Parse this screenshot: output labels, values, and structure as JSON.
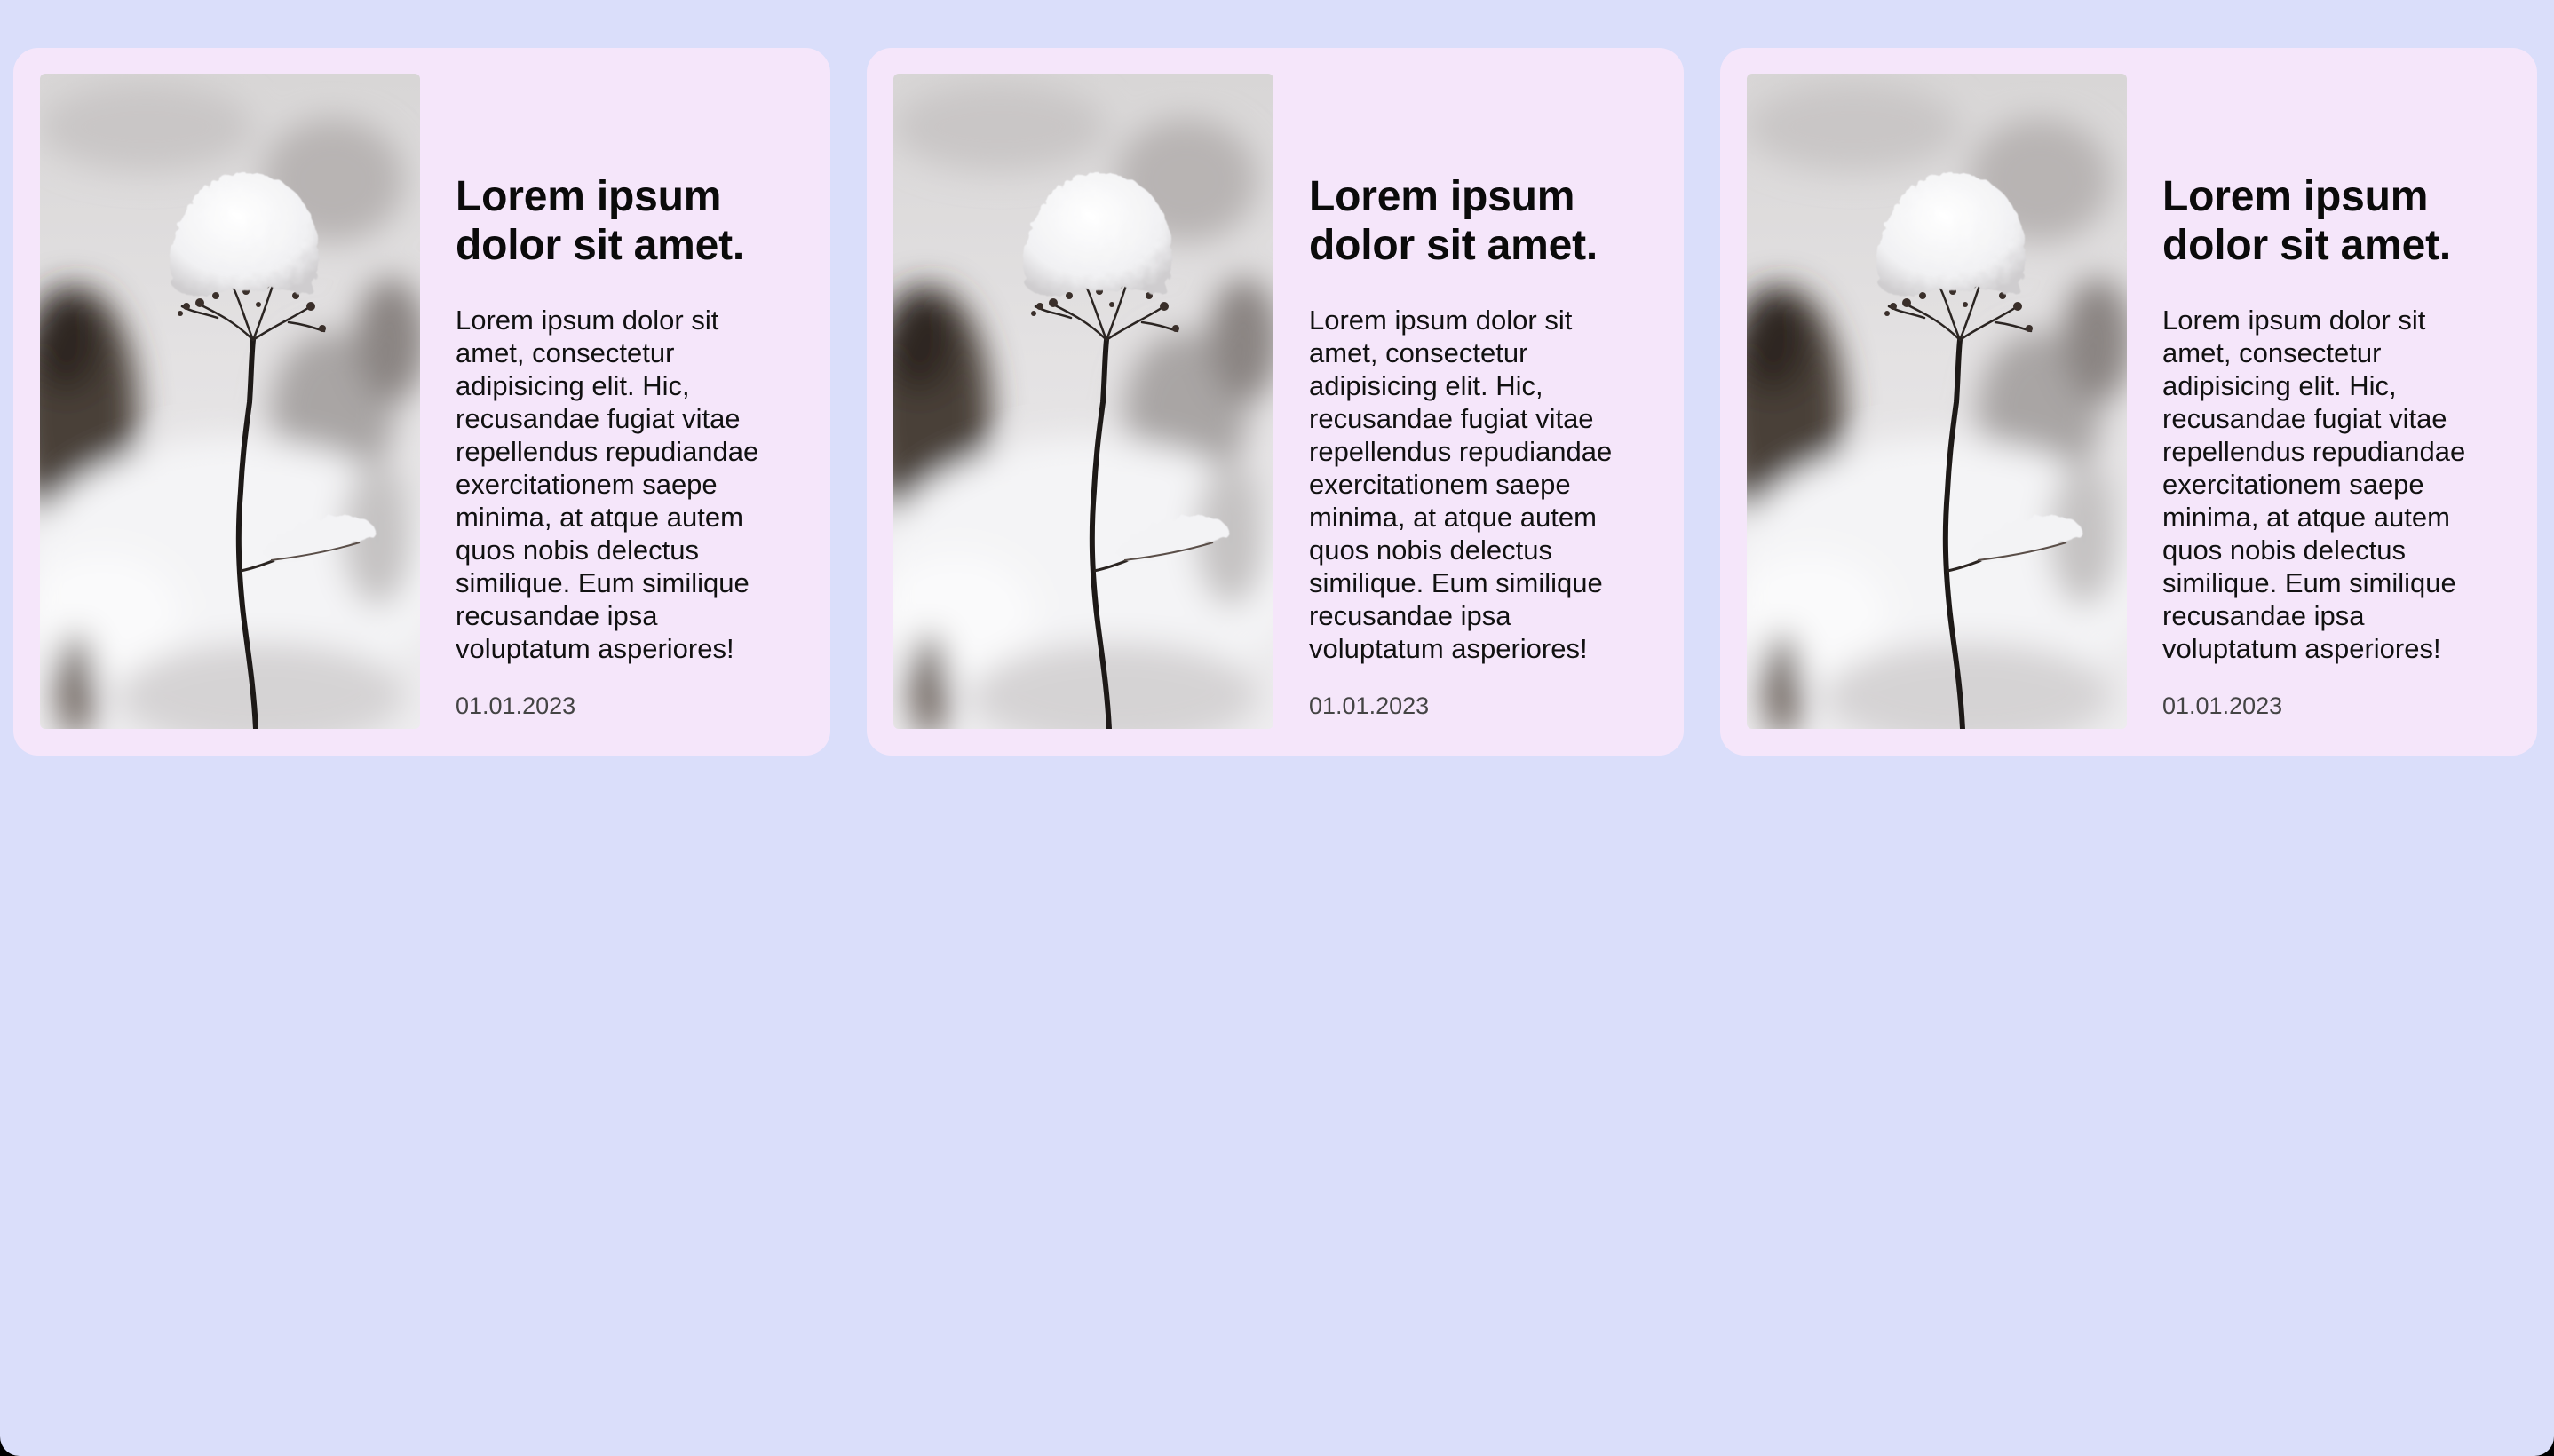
{
  "colors": {
    "background": "#dadefa",
    "card_background": "#f5e6fa",
    "title_text": "#0b0b0b",
    "body_text": "#111111",
    "date_text": "#444444"
  },
  "cards": [
    {
      "image_icon": "snow-covered-plant-photo",
      "title": "Lorem ipsum dolor sit amet.",
      "text": "Lorem ipsum dolor sit amet, consectetur adipisicing elit. Hic, recusandae fugiat vitae repellendus repudiandae exercitationem saepe minima, at atque autem quos nobis delectus similique. Eum similique recusandae ipsa voluptatum asperiores!",
      "date": "01.01.2023"
    },
    {
      "image_icon": "snow-covered-plant-photo",
      "title": "Lorem ipsum dolor sit amet.",
      "text": "Lorem ipsum dolor sit amet, consectetur adipisicing elit. Hic, recusandae fugiat vitae repellendus repudiandae exercitationem saepe minima, at atque autem quos nobis delectus similique. Eum similique recusandae ipsa voluptatum asperiores!",
      "date": "01.01.2023"
    },
    {
      "image_icon": "snow-covered-plant-photo",
      "title": "Lorem ipsum dolor sit amet.",
      "text": "Lorem ipsum dolor sit amet, consectetur adipisicing elit. Hic, recusandae fugiat vitae repellendus repudiandae exercitationem saepe minima, at atque autem quos nobis delectus similique. Eum similique recusandae ipsa voluptatum asperiores!",
      "date": "01.01.2023"
    }
  ]
}
